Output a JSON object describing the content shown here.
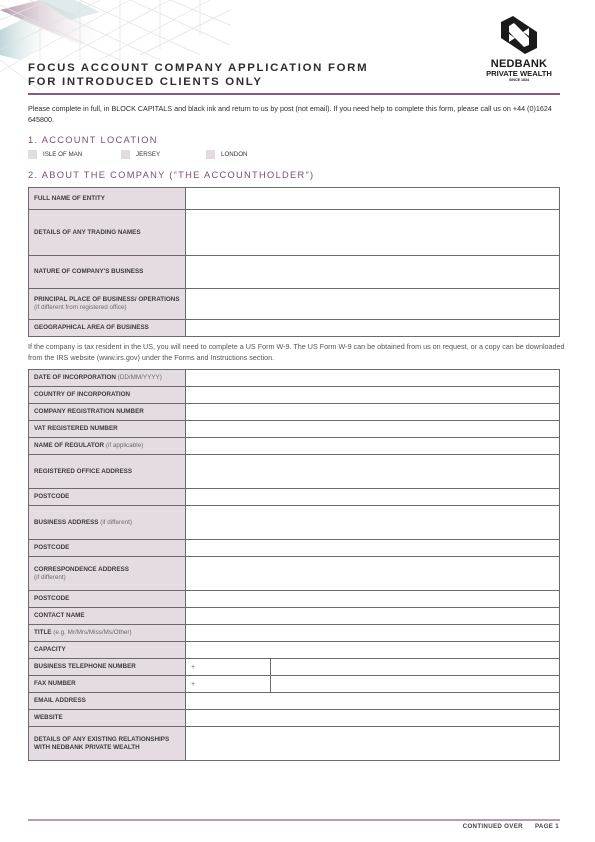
{
  "header": {
    "title_line1": "FOCUS ACCOUNT COMPANY APPLICATION FORM",
    "title_line2": "FOR INTRODUCED CLIENTS ONLY",
    "logo": {
      "icon": "nedbank-n-logo-icon",
      "brand": "NEDBANK",
      "sub": "PRIVATE WEALTH",
      "since": "SINCE 1834"
    }
  },
  "intro": "Please complete in full, in BLOCK CAPITALS and black ink and return to us by post (not email). If you need help to complete this form, please call us on +44 (0)1624 645800.",
  "section1": {
    "heading": "1. ACCOUNT LOCATION",
    "options": [
      {
        "label": "ISLE OF MAN",
        "checked": false
      },
      {
        "label": "JERSEY",
        "checked": false
      },
      {
        "label": "LONDON",
        "checked": false
      }
    ]
  },
  "section2": {
    "heading": "2. ABOUT THE COMPANY (“THE ACCOUNTHOLDER”)",
    "table1": [
      {
        "label": "FULL NAME OF ENTITY",
        "hint": "",
        "value": ""
      },
      {
        "label": "DETAILS OF ANY TRADING NAMES",
        "hint": "",
        "value": ""
      },
      {
        "label": "NATURE OF COMPANY'S BUSINESS",
        "hint": "",
        "value": ""
      },
      {
        "label": "PRINCIPAL PLACE OF BUSINESS/ OPERATIONS",
        "hint": "(if different from registered office)",
        "value": ""
      },
      {
        "label": "GEOGRAPHICAL AREA OF BUSINESS",
        "hint": "",
        "value": ""
      }
    ],
    "us_note": "If the company is tax resident in the US, you will need to complete a US Form W-9. The US Form W-9 can be obtained from us on request, or a copy can be downloaded from the IRS website (www.irs.gov) under the Forms and Instructions section.",
    "table2": [
      {
        "label": "DATE OF INCORPORATION",
        "hint": "(DD/MM/YYYY)",
        "value": ""
      },
      {
        "label": "COUNTRY OF INCORPORATION",
        "hint": "",
        "value": ""
      },
      {
        "label": "COMPANY REGISTRATION NUMBER",
        "hint": "",
        "value": ""
      },
      {
        "label": "VAT REGISTERED NUMBER",
        "hint": "",
        "value": ""
      },
      {
        "label": "NAME OF REGULATOR",
        "hint": "(if applicable)",
        "value": ""
      },
      {
        "label": "REGISTERED OFFICE ADDRESS",
        "hint": "",
        "value": ""
      },
      {
        "label": "POSTCODE",
        "hint": "",
        "value": ""
      },
      {
        "label": "BUSINESS ADDRESS",
        "hint": "(if different)",
        "value": ""
      },
      {
        "label": "POSTCODE",
        "hint": "",
        "value": ""
      },
      {
        "label": "CORRESPONDENCE ADDRESS",
        "hint": "(if different)",
        "value": ""
      },
      {
        "label": "POSTCODE",
        "hint": "",
        "value": ""
      },
      {
        "label": "CONTACT NAME",
        "hint": "",
        "value": ""
      },
      {
        "label": "TITLE",
        "hint": "(e.g. Mr/Mrs/Miss/Ms/Other)",
        "value": ""
      },
      {
        "label": "CAPACITY",
        "hint": "",
        "value": ""
      },
      {
        "label": "BUSINESS TELEPHONE NUMBER",
        "hint": "",
        "prefix": "+",
        "value": ""
      },
      {
        "label": "FAX NUMBER",
        "hint": "",
        "prefix": "+",
        "value": ""
      },
      {
        "label": "EMAIL ADDRESS",
        "hint": "",
        "value": ""
      },
      {
        "label": "WEBSITE",
        "hint": "",
        "value": ""
      },
      {
        "label": "DETAILS OF ANY EXISTING RELATIONSHIPS WITH NEDBANK PRIVATE WEALTH",
        "hint": "",
        "value": ""
      }
    ]
  },
  "footer": {
    "continued": "CONTINUED OVER",
    "page": "PAGE 1"
  },
  "colors": {
    "accent": "#7b4f73",
    "label_bg": "#e5dce3",
    "rule": "#8a5a80"
  }
}
